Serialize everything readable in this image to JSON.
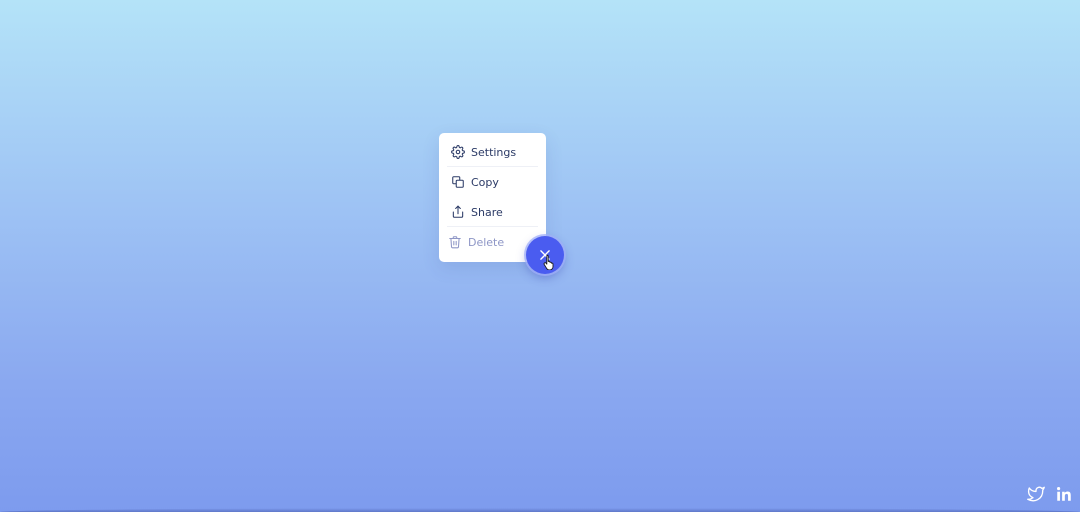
{
  "menu": {
    "items": [
      {
        "label": "Settings",
        "icon": "gear-icon"
      },
      {
        "label": "Copy",
        "icon": "copy-icon"
      },
      {
        "label": "Share",
        "icon": "share-icon"
      },
      {
        "label": "Delete",
        "icon": "trash-icon"
      }
    ]
  },
  "fab": {
    "icon": "close-icon"
  },
  "social": {
    "twitter": {
      "icon": "twitter-icon"
    },
    "linkedin": {
      "icon": "linkedin-icon"
    }
  },
  "colors": {
    "accent": "#4a5cf0",
    "menu_text": "#2b3a66",
    "delete_text": "#8e96c6",
    "background_top": "#b4e3f8",
    "background_bottom": "#7d9bee"
  }
}
